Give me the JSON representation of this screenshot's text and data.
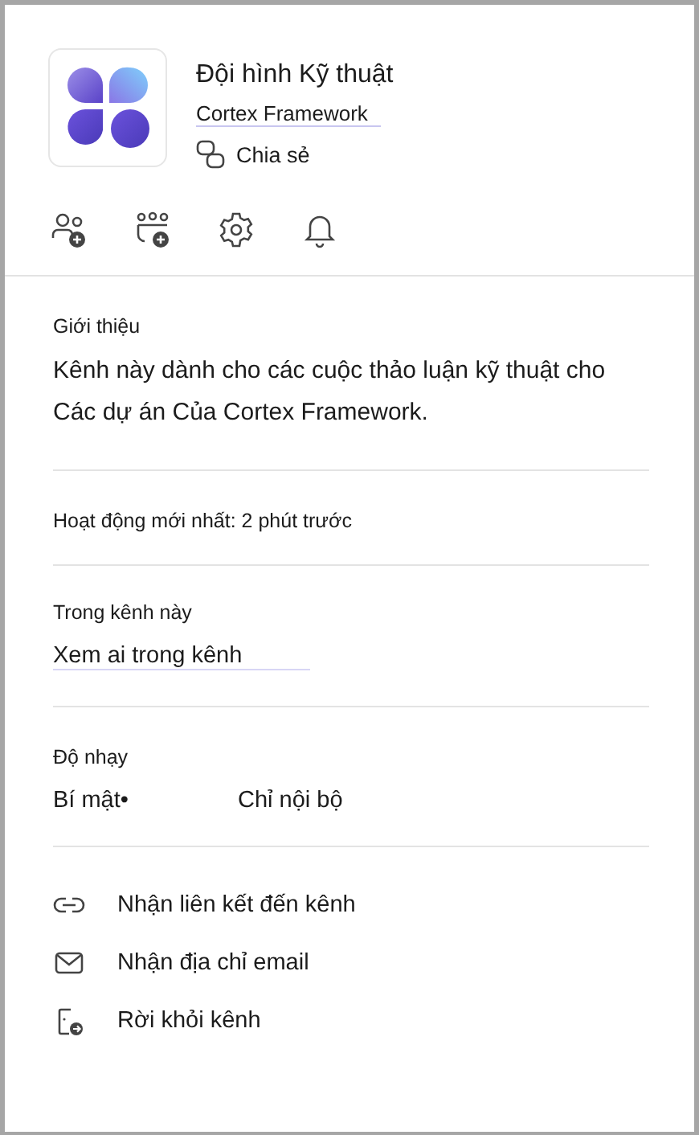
{
  "channel": {
    "name": "Đội hình Kỹ thuật",
    "team": "Cortex Framework",
    "share": "Chia sẻ"
  },
  "about": {
    "heading": "Giới thiệu",
    "description": "Kênh này dành cho các cuộc thảo luận kỹ thuật cho Các dự án Của Cortex Framework."
  },
  "activity": "Hoạt động mới nhất: 2 phút trước",
  "members": {
    "heading": "Trong kênh này",
    "link": "Xem ai trong kênh"
  },
  "sensitivity": {
    "heading": "Độ nhạy",
    "label": "Bí mật•",
    "value": "Chỉ nội bộ"
  },
  "actions": [
    {
      "kind": "link",
      "label": "Nhận liên kết đến kênh"
    },
    {
      "kind": "email",
      "label": "Nhận địa chỉ email"
    },
    {
      "kind": "leave",
      "label": "Rời khỏi kênh"
    }
  ]
}
